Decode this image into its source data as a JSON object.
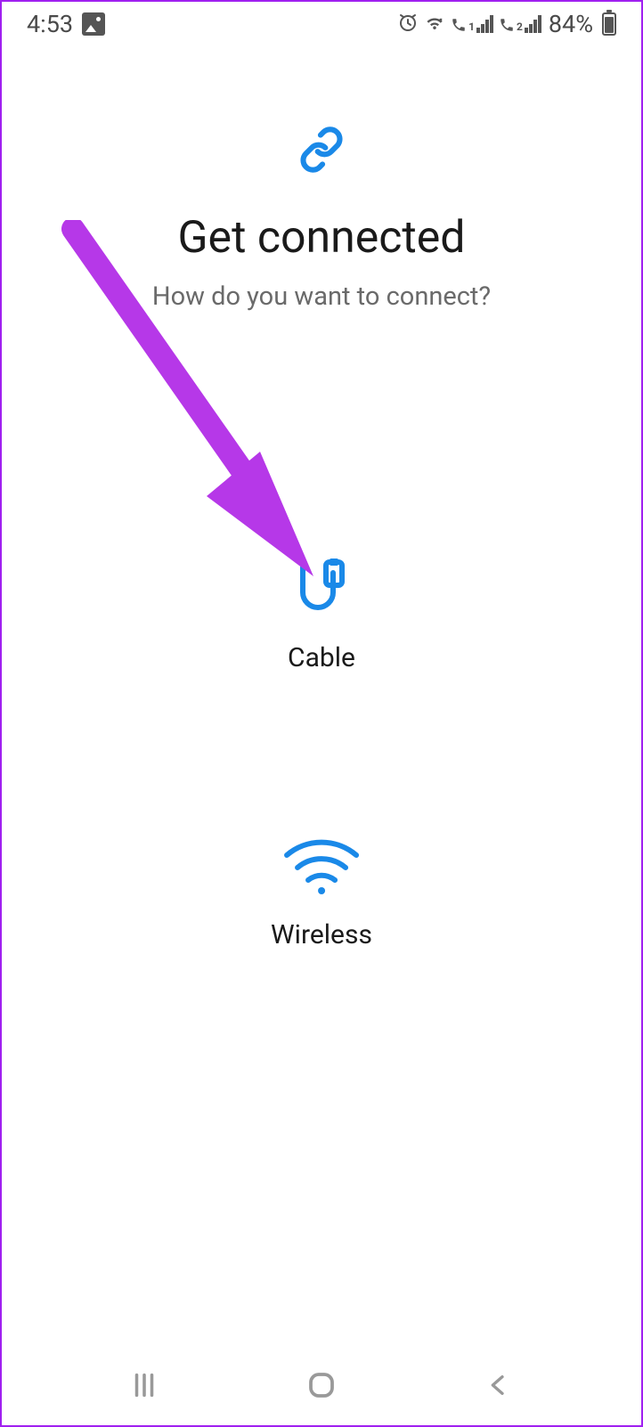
{
  "statusBar": {
    "time": "4:53",
    "batteryPercent": "84%"
  },
  "header": {
    "title": "Get connected",
    "subtitle": "How do you want to connect?"
  },
  "options": {
    "cable": "Cable",
    "wireless": "Wireless"
  }
}
